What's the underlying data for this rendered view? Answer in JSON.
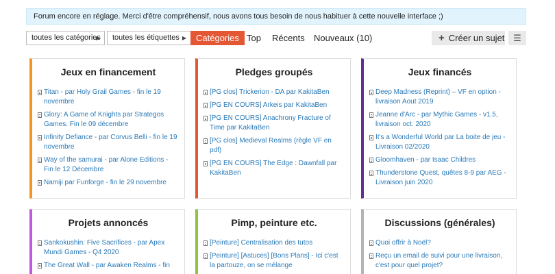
{
  "banner": {
    "text": "Forum encore en réglage. Merci d'être compréhensif, nous avons tous besoin de nous habituer à cette nouvelle interface ;)"
  },
  "nav": {
    "categories_dropdown": "toutes les catégories",
    "tags_dropdown": "toutes les étiquettes",
    "tabs": [
      "Catégories",
      "Top",
      "Récents",
      "Nouveaux (10)"
    ],
    "active_tab": "Catégories",
    "create_topic": "Créer un sujet",
    "menu_icon": "hamburger-icon"
  },
  "colors": {
    "accent": "#e45735",
    "banner_bg": "#e1f3fc",
    "link": "#2a7ab8",
    "category_borders": [
      "#f7941d",
      "#e45735",
      "#652d90",
      "#bf5ae0",
      "#8fc53d",
      "#b3b5b4"
    ]
  },
  "categories": [
    {
      "title": "Jeux en financement",
      "topics": [
        "Titan - par Holy Grail Games - fin le 19 novembre",
        "Glory: A Game of Knights par Strategos Games. Fin le 09 décembre",
        "Infinity Defiance - par Corvus Belli - fin le 19 novembre",
        "Way of the samurai - par Alone Editions - Fin le 12 Décembre",
        "Namiji par Funforge - fin le 29 novembre"
      ]
    },
    {
      "title": "Pledges groupés",
      "topics": [
        "[PG clos] Trickerion - DA par KakitaBen",
        "[PG EN COURS] Arkeis par KakitaBen",
        "[PG EN COURS] Anachrony Fracture of Time par KakitaBen",
        "[PG clos] Medieval Realms (règle VF en pdf)",
        "[PG EN COURS] The Edge : Dawnfall par KakitaBen"
      ]
    },
    {
      "title": "Jeux financés",
      "topics": [
        "Deep Madness (Reprint) – VF en option - livraison Aout 2019",
        "Jeanne d'Arc - par Mythic Games - v1.5, livraison oct. 2020",
        "It's a Wonderful World par La boite de jeu - Livraison 02/2020",
        "Gloomhaven - par Isaac Childres",
        "Thunderstone Quest, quêtes 8-9 par AEG - Livraison juin 2020"
      ]
    },
    {
      "title": "Projets annoncés",
      "topics": [
        "Sankokushin: Five Sacrifices - par Apex Mundi Games - Q4 2020",
        "The Great Wall - par Awaken Realms - fin"
      ]
    },
    {
      "title": "Pimp, peinture etc.",
      "topics": [
        "[Peinture] Centralisation des tutos",
        "[Peinture] [Astuces] [Bons Plans] - Ici c'est la partouze, on se mélange"
      ]
    },
    {
      "title": "Discussions (générales)",
      "topics": [
        "Quoi offrir à Noël?",
        "Reçu un email de suivi pour une livraison, c'est pour quel projet?"
      ]
    }
  ]
}
